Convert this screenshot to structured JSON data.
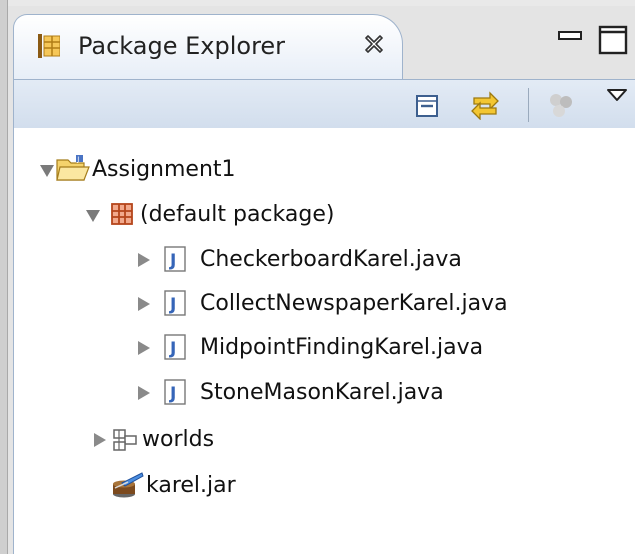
{
  "view": {
    "title": "Package Explorer",
    "icons": {
      "view": "package-explorer-icon",
      "close": "close-icon",
      "minimize": "minimize-icon",
      "maximize": "maximize-icon"
    }
  },
  "toolbar": {
    "buttons": [
      "collapse-all-icon",
      "link-with-editor-icon",
      "focus-icon",
      "view-menu-icon"
    ]
  },
  "tree": {
    "project": {
      "label": "Assignment1",
      "expanded": true
    },
    "default_package": {
      "label": "(default package)",
      "expanded": true
    },
    "files": [
      {
        "label": "CheckerboardKarel.java"
      },
      {
        "label": "CollectNewspaperKarel.java"
      },
      {
        "label": "MidpointFindingKarel.java"
      },
      {
        "label": "StoneMasonKarel.java"
      }
    ],
    "worlds": {
      "label": "worlds",
      "expanded": false
    },
    "jar": {
      "label": "karel.jar"
    }
  },
  "colors": {
    "accent": "#9fb3cc",
    "folder": "#f2c14e",
    "package": "#b5451b",
    "java": "#3565b8"
  }
}
